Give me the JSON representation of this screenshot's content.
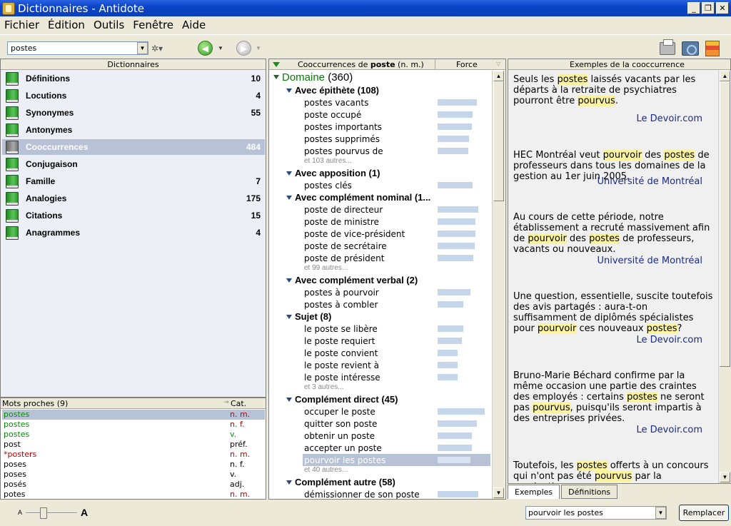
{
  "window": {
    "title": "Dictionnaires - Antidote",
    "minimize": "_",
    "restore": "❐",
    "close": "✕"
  },
  "menu": [
    "Fichier",
    "Édition",
    "Outils",
    "Fenêtre",
    "Aide"
  ],
  "toolbar": {
    "search_value": "postes"
  },
  "dictionaries": {
    "header": "Dictionnaires",
    "items": [
      {
        "label": "Définitions",
        "count": "10"
      },
      {
        "label": "Locutions",
        "count": "4"
      },
      {
        "label": "Synonymes",
        "count": "55"
      },
      {
        "label": "Antonymes",
        "count": ""
      },
      {
        "label": "Cooccurrences",
        "count": "484"
      },
      {
        "label": "Conjugaison",
        "count": ""
      },
      {
        "label": "Famille",
        "count": "7"
      },
      {
        "label": "Analogies",
        "count": "175"
      },
      {
        "label": "Citations",
        "count": "15"
      },
      {
        "label": "Anagrammes",
        "count": "4"
      }
    ]
  },
  "mots_proches": {
    "header": "Mots proches (9)",
    "cat_header": "Cat.",
    "rows": [
      {
        "word": "postes",
        "cat": "n. m."
      },
      {
        "word": "postes",
        "cat": "n. f."
      },
      {
        "word": "postes",
        "cat": "v."
      },
      {
        "word": "post",
        "cat": "préf."
      },
      {
        "word": "*posters",
        "cat": "n. m."
      },
      {
        "word": "poses",
        "cat": "n. f."
      },
      {
        "word": "poses",
        "cat": "v."
      },
      {
        "word": "posés",
        "cat": "adj."
      },
      {
        "word": "potes",
        "cat": "n. m."
      }
    ]
  },
  "cooccurrences": {
    "header_prefix": "Cooccurrences de ",
    "header_word": "poste",
    "header_suffix": " (n. m.)",
    "force_header": "Force",
    "domain": {
      "label": "Domaine",
      "count": "(360)"
    },
    "rows": [
      {
        "kind": "group",
        "text": "Avec épithète (108)"
      },
      {
        "kind": "item",
        "text": "postes vacants",
        "force": 0.84
      },
      {
        "kind": "item",
        "text": "poste occupé",
        "force": 0.74
      },
      {
        "kind": "item",
        "text": "postes importants",
        "force": 0.73
      },
      {
        "kind": "item",
        "text": "postes supprimés",
        "force": 0.67
      },
      {
        "kind": "item",
        "text": "postes pourvus de",
        "force": 0.65
      },
      {
        "kind": "more",
        "text": "et 103 autres..."
      },
      {
        "kind": "group",
        "text": "Avec apposition (1)"
      },
      {
        "kind": "item",
        "text": "postes clés",
        "force": 0.74
      },
      {
        "kind": "group",
        "text": "Avec complément nominal (1..."
      },
      {
        "kind": "item",
        "text": "poste de directeur",
        "force": 0.86
      },
      {
        "kind": "item",
        "text": "poste de ministre",
        "force": 0.81
      },
      {
        "kind": "item",
        "text": "poste de vice-président",
        "force": 0.81
      },
      {
        "kind": "item",
        "text": "poste de secrétaire",
        "force": 0.79
      },
      {
        "kind": "item",
        "text": "poste de président",
        "force": 0.75
      },
      {
        "kind": "more",
        "text": "et 99 autres..."
      },
      {
        "kind": "group",
        "text": "Avec complément verbal (2)"
      },
      {
        "kind": "item",
        "text": "postes à pourvoir",
        "force": 0.69
      },
      {
        "kind": "item",
        "text": "postes à combler",
        "force": 0.55
      },
      {
        "kind": "group",
        "text": "Sujet (8)"
      },
      {
        "kind": "item",
        "text": "le poste se libère",
        "force": 0.54
      },
      {
        "kind": "item",
        "text": "le poste requiert",
        "force": 0.51
      },
      {
        "kind": "item",
        "text": "le poste convient",
        "force": 0.43
      },
      {
        "kind": "item",
        "text": "le poste revient à",
        "force": 0.42
      },
      {
        "kind": "item",
        "text": "le poste intéresse",
        "force": 0.42
      },
      {
        "kind": "more",
        "text": "et 3 autres..."
      },
      {
        "kind": "group",
        "text": "Complément direct (45)"
      },
      {
        "kind": "item",
        "text": "occuper le poste",
        "force": 1.0
      },
      {
        "kind": "item",
        "text": "quitter son poste",
        "force": 0.84
      },
      {
        "kind": "item",
        "text": "obtenir un poste",
        "force": 0.73
      },
      {
        "kind": "item",
        "text": "accepter un poste",
        "force": 0.73
      },
      {
        "kind": "item",
        "text": "pourvoir les postes",
        "force": 0.7,
        "selected": true
      },
      {
        "kind": "more",
        "text": "et 40 autres..."
      },
      {
        "kind": "group",
        "text": "Complément autre (58)"
      },
      {
        "kind": "item",
        "text": "démissionner de son poste",
        "force": 0.86
      }
    ]
  },
  "examples": {
    "header": "Exemples de la cooccurrence",
    "items": [
      {
        "html": "Seuls les <span class=\"hl\">postes</span> laissés vacants par les départs à la retraite de psychiatres pourront être <span class=\"hl\">pourvus</span>.",
        "source": "Le Devoir.com"
      },
      {
        "html": "HEC Montréal veut <span class=\"hl\">pourvoir</span> des <span class=\"hl\">postes</span> de professeurs dans tous les domaines de la gestion au 1er juin 2005.",
        "source": "Université de Montréal"
      },
      {
        "html": "Au cours de cette période, notre établissement a recruté massivement afin de <span class=\"hl\">pourvoir</span> des <span class=\"hl\">postes</span> de professeurs, vacants ou nouveaux.",
        "source": "Université de Montréal"
      },
      {
        "html": "Une question, essentielle, suscite toutefois des avis partagés : aura-t-on suffisamment de diplômés spécialistes pour <span class=\"hl\">pourvoir</span> ces nouveaux <span class=\"hl\">postes</span>?",
        "source": "Le Devoir.com"
      },
      {
        "html": "Bruno-Marie Béchard confirme par la même occasion une partie des craintes des employés : certains <span class=\"hl\">postes</span> ne seront pas <span class=\"hl\">pourvus</span>, puisqu'ils seront impartis à des entreprises privées.",
        "source": "Le Devoir.com"
      },
      {
        "html": "Toutefois, les <span class=\"hl\">postes</span> offerts à un concours qui n'ont pas été <span class=\"hl\">pourvus</span> par la nomination",
        "source": ""
      }
    ]
  },
  "tabs": [
    "Exemples",
    "Définitions"
  ],
  "status": {
    "zoom_small": "A",
    "zoom_big": "A",
    "replace_value": "pourvoir les postes",
    "replace_button": "Remplacer"
  }
}
